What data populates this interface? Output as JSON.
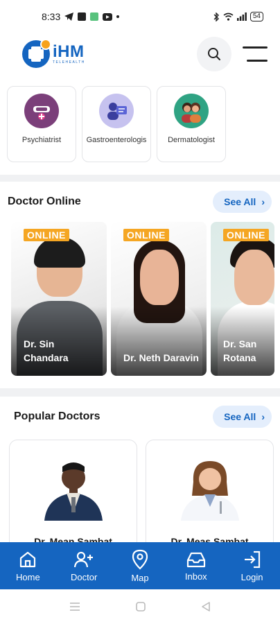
{
  "status_bar": {
    "time": "8:33",
    "battery": "54"
  },
  "app": {
    "logo_title": "iHM",
    "logo_sub": "TELEHEALTH"
  },
  "specialties": [
    {
      "label": "Psychiatrist",
      "icon": "psychiatrist-icon",
      "color": "#7b3f7a"
    },
    {
      "label": "Gastroenterologis",
      "icon": "gastroenterologist-icon",
      "color": "#c6c2ef"
    },
    {
      "label": "Dermatologist",
      "icon": "dermatologist-icon",
      "color": "#2fa383"
    }
  ],
  "doctor_online": {
    "title": "Doctor Online",
    "see_all": "See All",
    "badge": "ONLINE",
    "doctors": [
      {
        "name": "Dr. Sin Chandara"
      },
      {
        "name": "Dr. Neth Daravin"
      },
      {
        "name": "Dr. San Rotana"
      }
    ]
  },
  "popular_doctors": {
    "title": "Popular Doctors",
    "see_all": "See All",
    "doctors": [
      {
        "name": "Dr. Mean Sambat"
      },
      {
        "name": "Dr. Meas Sambat"
      }
    ]
  },
  "bottom_nav": [
    {
      "label": "Home",
      "icon": "home-icon"
    },
    {
      "label": "Doctor",
      "icon": "add-user-icon"
    },
    {
      "label": "Map",
      "icon": "map-pin-icon"
    },
    {
      "label": "Inbox",
      "icon": "inbox-icon"
    },
    {
      "label": "Login",
      "icon": "login-icon"
    }
  ],
  "colors": {
    "brand": "#1565c0",
    "online": "#f5a623",
    "see_all_bg": "#e4eefc"
  }
}
